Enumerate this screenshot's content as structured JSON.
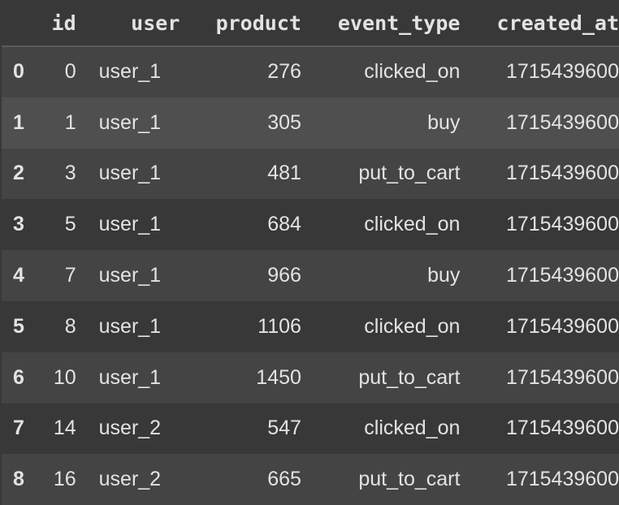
{
  "dataframe": {
    "columns": [
      "",
      "id",
      "user",
      "product",
      "event_type",
      "created_at"
    ],
    "rows": [
      {
        "index": "0",
        "id": "0",
        "user": "user_1",
        "product": "276",
        "event_type": "clicked_on",
        "created_at": "1715439600"
      },
      {
        "index": "1",
        "id": "1",
        "user": "user_1",
        "product": "305",
        "event_type": "buy",
        "created_at": "1715439600"
      },
      {
        "index": "2",
        "id": "3",
        "user": "user_1",
        "product": "481",
        "event_type": "put_to_cart",
        "created_at": "1715439600"
      },
      {
        "index": "3",
        "id": "5",
        "user": "user_1",
        "product": "684",
        "event_type": "clicked_on",
        "created_at": "1715439600"
      },
      {
        "index": "4",
        "id": "7",
        "user": "user_1",
        "product": "966",
        "event_type": "buy",
        "created_at": "1715439600"
      },
      {
        "index": "5",
        "id": "8",
        "user": "user_1",
        "product": "1106",
        "event_type": "clicked_on",
        "created_at": "1715439600"
      },
      {
        "index": "6",
        "id": "10",
        "user": "user_1",
        "product": "1450",
        "event_type": "put_to_cart",
        "created_at": "1715439600"
      },
      {
        "index": "7",
        "id": "14",
        "user": "user_2",
        "product": "547",
        "event_type": "clicked_on",
        "created_at": "1715439600"
      },
      {
        "index": "8",
        "id": "16",
        "user": "user_2",
        "product": "665",
        "event_type": "put_to_cart",
        "created_at": "1715439600"
      }
    ],
    "hovered_row_index": "1"
  },
  "colors": {
    "background": "#383838",
    "row_striped": "#444444",
    "row_hover": "#4f4f4f",
    "text": "#e3e3e3",
    "header_border": "#5a5a5a"
  }
}
